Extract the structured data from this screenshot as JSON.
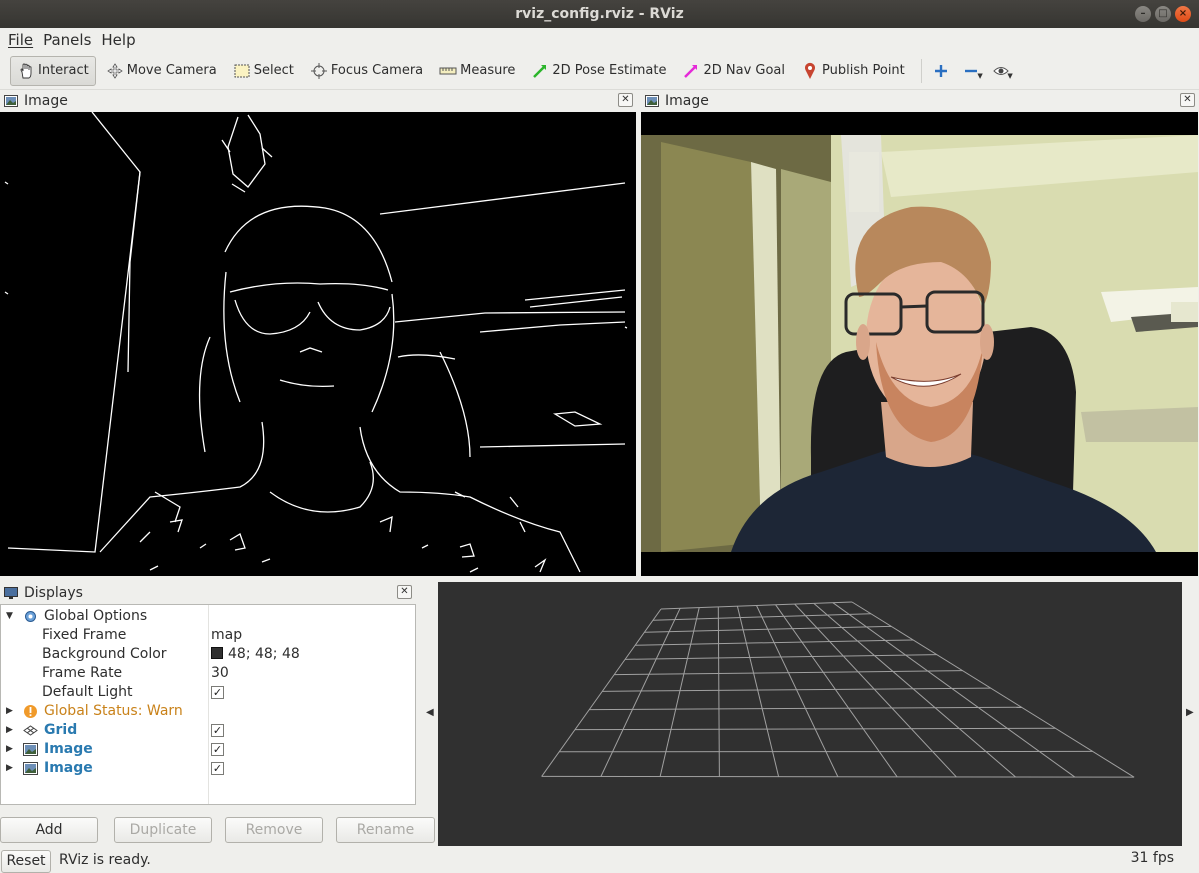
{
  "window": {
    "title": "rviz_config.rviz - RViz"
  },
  "menu": [
    "File",
    "Panels",
    "Help"
  ],
  "toolbar": {
    "interact": "Interact",
    "move_camera": "Move Camera",
    "select": "Select",
    "focus_camera": "Focus Camera",
    "measure": "Measure",
    "pose_estimate": "2D Pose Estimate",
    "nav_goal": "2D Nav Goal",
    "publish_point": "Publish Point",
    "icons": [
      "plus-icon",
      "minus-icon",
      "eye-icon"
    ]
  },
  "panels": {
    "left_image_title": "Image",
    "right_image_title": "Image"
  },
  "displays": {
    "title": "Displays",
    "global_options": "Global Options",
    "fixed_frame_label": "Fixed Frame",
    "fixed_frame_value": "map",
    "background_color_label": "Background Color",
    "background_color_value": "48; 48; 48",
    "frame_rate_label": "Frame Rate",
    "frame_rate_value": "30",
    "default_light_label": "Default Light",
    "global_status": "Global Status: Warn",
    "grid": "Grid",
    "image_1": "Image",
    "image_2": "Image"
  },
  "buttons": {
    "add": "Add",
    "duplicate": "Duplicate",
    "remove": "Remove",
    "rename": "Rename"
  },
  "status": {
    "reset": "Reset",
    "message": "RViz is ready.",
    "fps": "31 fps"
  },
  "colors": {
    "background": "#303030",
    "titlebar": "#3c3b37",
    "link_blue": "#2a7ab0",
    "warn": "#c9821a"
  }
}
